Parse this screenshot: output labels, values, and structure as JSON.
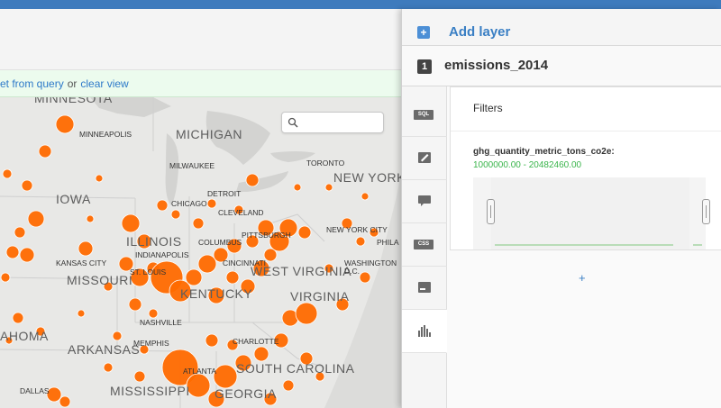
{
  "notice": {
    "link1": "et from query",
    "mid": "or",
    "link2": "clear view"
  },
  "map": {
    "search_placeholder": "",
    "states": [
      "MINNESOTA",
      "MICHIGAN",
      "IOWA",
      "NEW YORK",
      "ILLINOIS",
      "MISSOURI",
      "KENTUCKY",
      "WEST VIRGINIA",
      "VIRGINIA",
      "ARKANSAS",
      "AHOMA",
      "SOUTH CAROLINA",
      "MISSISSIPPI",
      "GEORGIA"
    ],
    "cities": [
      "MINNEAPOLIS",
      "MILWAUKEE",
      "DETROIT",
      "TORONTO",
      "CHICAGO",
      "CLEVELAND",
      "INDIANAPOLIS",
      "COLUMBUS",
      "PITTSBURGH",
      "NEW YORK CITY",
      "PHILA",
      "KANSAS CITY",
      "ST. LOUIS",
      "CINCINNATI",
      "WASHINGTON",
      "D.C.",
      "NASHVILLE",
      "MEMPHIS",
      "CHARLOTTE",
      "ATLANTA",
      "DALLAS"
    ],
    "marker_color": "#ff6a00",
    "background_color": "#e6e6e4"
  },
  "panel": {
    "add_layer_label": "Add layer",
    "layer_number": "1",
    "layer_name": "emissions_2014",
    "tabs": [
      {
        "id": "sql",
        "icon": "sql-icon",
        "label": "SQL"
      },
      {
        "id": "style",
        "icon": "brush-icon"
      },
      {
        "id": "infowindow",
        "icon": "speech-bubble-icon"
      },
      {
        "id": "css",
        "icon": "css-icon",
        "label": "CSS"
      },
      {
        "id": "legend",
        "icon": "legend-icon"
      },
      {
        "id": "filters",
        "icon": "histogram-icon"
      }
    ],
    "filters": {
      "title": "Filters",
      "field_name": "ghg_quantity_metric_tons_co2e:",
      "range": "1000000.00 - 20482460.00",
      "add_label": "+"
    }
  }
}
